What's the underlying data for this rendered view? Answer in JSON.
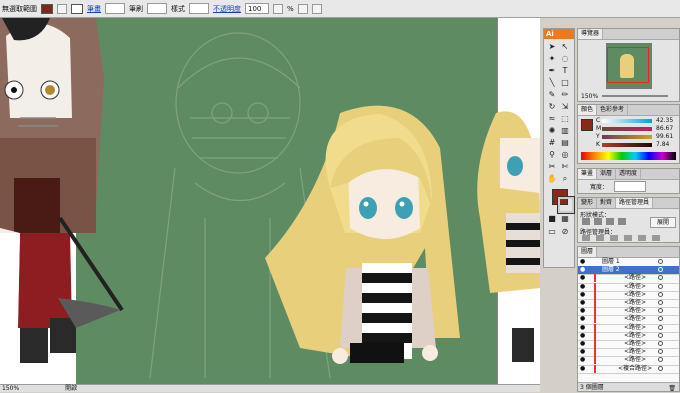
{
  "control_bar": {
    "selection_label": "無選取範圍",
    "stroke_label": "筆畫",
    "brush_label": "筆刷",
    "style_label": "樣式",
    "opacity_label": "不透明度",
    "opacity_value": "100",
    "percent": "%",
    "fill_color": "#7a2a1a"
  },
  "canvas": {
    "artboard_color": "#5e8b62"
  },
  "status_bar": {
    "zoom": "150%",
    "mode": "開啟"
  },
  "toolbox": {
    "app_badge": "Ai"
  },
  "navigator_panel": {
    "tab": "導覽器",
    "zoom": "150%"
  },
  "color_panel": {
    "tabs": [
      "顏色",
      "色彩參考"
    ],
    "channels": [
      {
        "name": "C",
        "value": "42.35",
        "percent": 42.35
      },
      {
        "name": "M",
        "value": "86.67",
        "percent": 86.67
      },
      {
        "name": "Y",
        "value": "99.61",
        "percent": 99.61
      },
      {
        "name": "K",
        "value": "7.84",
        "percent": 7.84
      }
    ]
  },
  "brush_panel": {
    "tabs": [
      "筆畫",
      "漸層",
      "透明度"
    ],
    "width_label": "寬度："
  },
  "pathfinder_panel": {
    "tabs": [
      "變形",
      "對齊",
      "路徑管理員"
    ],
    "shape_mode_label": "形狀模式：",
    "expand_button": "展開",
    "pathfinder_label": "路徑管理員："
  },
  "layers_panel": {
    "tab": "圖層",
    "footer": "3 個圖層",
    "layers": [
      {
        "name": "圖層 1",
        "type": "layer",
        "indent": 0
      },
      {
        "name": "圖層 2",
        "type": "layer-selected",
        "indent": 0
      },
      {
        "name": "<路徑>",
        "type": "path",
        "indent": 1
      },
      {
        "name": "<路徑>",
        "type": "path",
        "indent": 1
      },
      {
        "name": "<路徑>",
        "type": "path",
        "indent": 1
      },
      {
        "name": "<路徑>",
        "type": "path",
        "indent": 1
      },
      {
        "name": "<路徑>",
        "type": "path",
        "indent": 1
      },
      {
        "name": "<路徑>",
        "type": "path",
        "indent": 1
      },
      {
        "name": "<路徑>",
        "type": "path",
        "indent": 1
      },
      {
        "name": "<路徑>",
        "type": "path",
        "indent": 1
      },
      {
        "name": "<路徑>",
        "type": "path",
        "indent": 1
      },
      {
        "name": "<路徑>",
        "type": "path",
        "indent": 1
      },
      {
        "name": "<路徑>",
        "type": "path",
        "indent": 1
      },
      {
        "name": "<複合路徑>",
        "type": "path",
        "indent": 1
      }
    ]
  }
}
